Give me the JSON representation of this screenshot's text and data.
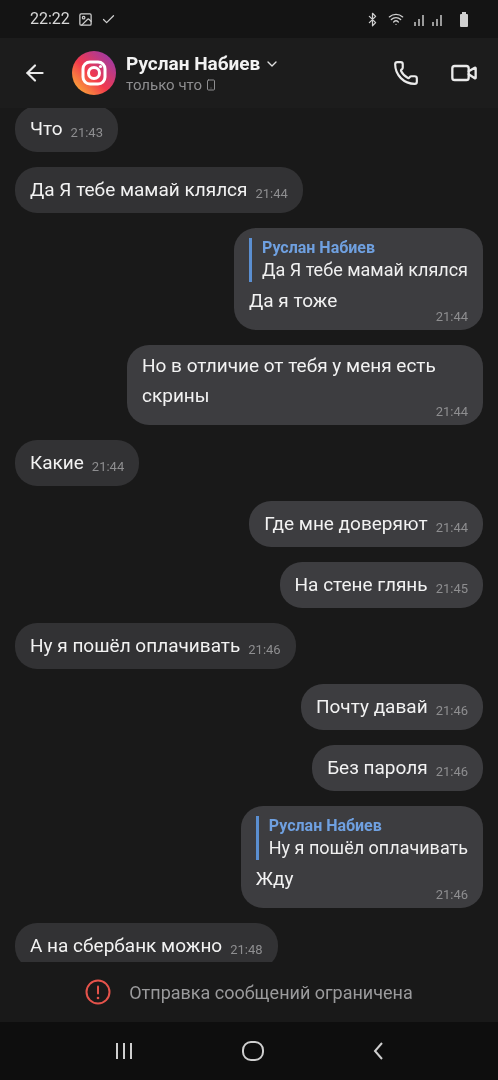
{
  "status_bar": {
    "time": "22:22"
  },
  "header": {
    "name": "Руслан Набиев",
    "status": "только что"
  },
  "messages": [
    {
      "outgoing": false,
      "kind": "inline",
      "text": "Что",
      "time": "21:43"
    },
    {
      "outgoing": false,
      "kind": "inline",
      "text": "Да Я тебе мамай клялся",
      "time": "21:44"
    },
    {
      "outgoing": true,
      "kind": "stacked",
      "reply": {
        "author": "Руслан Набиев",
        "text": "Да Я тебе мамай клялся"
      },
      "text": "Да я тоже",
      "time": "21:44"
    },
    {
      "outgoing": true,
      "kind": "stacked",
      "text": "Но в отличие от тебя у меня есть скрины",
      "time": "21:44"
    },
    {
      "outgoing": false,
      "kind": "inline",
      "text": "Какие",
      "time": "21:44"
    },
    {
      "outgoing": true,
      "kind": "inline",
      "text": "Где мне доверяют",
      "time": "21:44"
    },
    {
      "outgoing": true,
      "kind": "inline",
      "text": "На стене глянь",
      "time": "21:45"
    },
    {
      "outgoing": false,
      "kind": "inline",
      "text": "Ну я пошёл оплачивать",
      "time": "21:46"
    },
    {
      "outgoing": true,
      "kind": "inline",
      "text": "Почту давай",
      "time": "21:46"
    },
    {
      "outgoing": true,
      "kind": "inline",
      "text": "Без пароля",
      "time": "21:46"
    },
    {
      "outgoing": true,
      "kind": "stacked",
      "reply": {
        "author": "Руслан Набиев",
        "text": "Ну я пошёл оплачивать"
      },
      "text": "Жду",
      "time": "21:46"
    },
    {
      "outgoing": false,
      "kind": "inline",
      "text": "А на сбербанк можно",
      "time": "21:48"
    }
  ],
  "notice": "Отправка сообщений ограничена"
}
